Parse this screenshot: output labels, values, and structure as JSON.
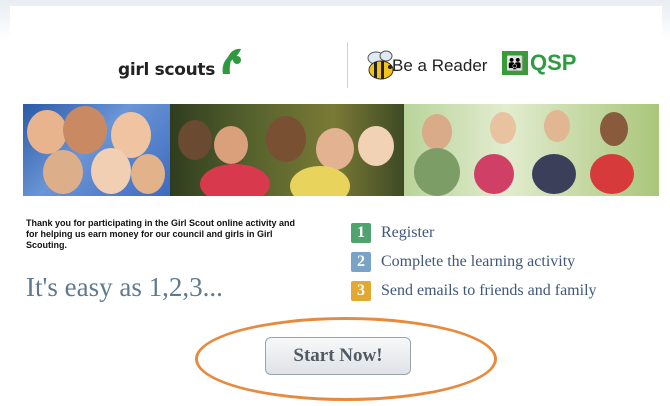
{
  "header": {
    "girl_scouts_logo_text": "girl scouts",
    "be_a_reader_text": "Be a Reader",
    "qsp_logo_text": "QSP"
  },
  "banner": {
    "icon": "photo-collage-of-girl-scouts"
  },
  "intro": {
    "thanks_text": "Thank you for participating in the Girl Scout online activity and for helping us earn money for our council and girls in Girl Scouting.",
    "easy_text": "It's easy as 1,2,3..."
  },
  "steps": [
    {
      "number": "1",
      "label": "Register",
      "color": "#4fa36e"
    },
    {
      "number": "2",
      "label": "Complete the learning activity",
      "color": "#7aa4c7"
    },
    {
      "number": "3",
      "label": "Send emails to friends and family",
      "color": "#e3a832"
    }
  ],
  "cta": {
    "start_label": "Start Now!",
    "highlight_color": "#e88a3d"
  }
}
